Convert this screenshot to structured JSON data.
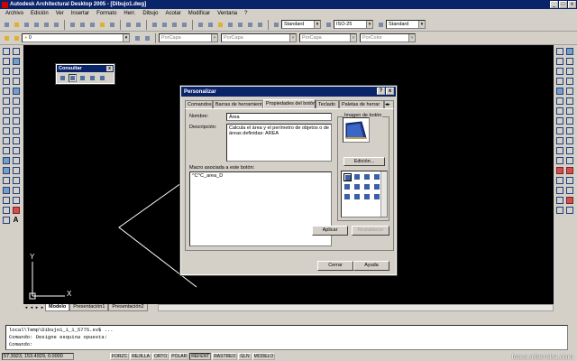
{
  "window": {
    "title": "Autodesk Architectural Desktop 2005 - [Dibujo1.dwg]",
    "min": "_",
    "max": "□",
    "close": "x"
  },
  "menu": [
    "Archivo",
    "Edición",
    "Ver",
    "Insertar",
    "Formato",
    "Herr.",
    "Dibujo",
    "Acotar",
    "Modificar",
    "Ventana",
    "?"
  ],
  "toolbar1": {
    "text_style": "Standard",
    "dim_style": "ISO-25",
    "table_style": "Standard"
  },
  "toolbar2": {
    "layer": "0",
    "color": "PorCapa",
    "linetype": "PorCapa",
    "lineweight": "PorCapa",
    "plotstyle": "PorColor"
  },
  "consultar": {
    "title": "Consultar",
    "close": "x"
  },
  "dialog": {
    "title": "Personalizar",
    "help": "?",
    "close": "x",
    "tabs": [
      "Comandos",
      "Barras de herramientas",
      "Propiedades del botón",
      "Teclado",
      "Paletas de herrar"
    ],
    "active_tab": 2,
    "name_label": "Nombre:",
    "name_value": "Área",
    "desc_label": "Descripción:",
    "desc_value": "Calcula el área y el perímetro de objetos o de áreas definidas: AREA",
    "macro_label": "Macro asociada a este botón:",
    "macro_value": "^C^C_area_D",
    "image_label": "Imagen de botón",
    "edit_button": "Edición...",
    "apply_button": "Aplicar",
    "reset_button": "Restablecer",
    "close_button": "Cerrar",
    "help_button": "Ayuda"
  },
  "layout_tabs": [
    "Modelo",
    "Presentación1",
    "Presentación2"
  ],
  "command_lines": [
    "local\\Temp\\Dibujo1_1_1_5775.sv$ ...",
    "Comando: Designe esquina opuesta:",
    "Comando:"
  ],
  "status": {
    "coords": "57.3923, 153.4929, 0.0000",
    "buttons": [
      "FORZC",
      "REJILLA",
      "ORTO",
      "POLAR",
      "REFENT",
      "RASTREO",
      "GLN",
      "MODELO"
    ],
    "on": [
      4
    ]
  },
  "ucs": {
    "x": "X",
    "y": "Y"
  },
  "watermark": "fotos.miarroba.com"
}
